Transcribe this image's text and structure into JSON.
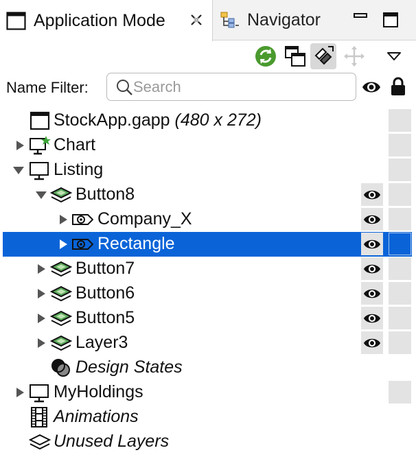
{
  "tabs": {
    "active": {
      "label": "Application Mode",
      "icon": "window-icon",
      "close_icon": "close-icon"
    },
    "inactive": {
      "label": "Navigator",
      "icon": "hierarchy-icon"
    }
  },
  "window_controls": {
    "minimize": "minimize-icon",
    "maximize": "maximize-icon"
  },
  "toolbar": {
    "buttons": [
      "refresh-icon",
      "new-window-icon",
      "link-with-editor-icon",
      "move-icon",
      "view-menu-icon"
    ]
  },
  "filter": {
    "label": "Name Filter:",
    "placeholder": "Search",
    "value": ""
  },
  "tree": {
    "rows": [
      {
        "label": "StockApp.gapp",
        "suffix": " (480 x 272)",
        "icon": "application-icon",
        "expand": "none"
      },
      {
        "label": "Chart",
        "icon": "screen-star-icon",
        "expand": "collapsed"
      },
      {
        "label": "Listing",
        "icon": "screen-icon",
        "expand": "expanded"
      },
      {
        "label": "Button8",
        "icon": "layer-icon",
        "expand": "expanded",
        "visible": true
      },
      {
        "label": "Company_X",
        "icon": "widget-eye-icon",
        "expand": "collapsed",
        "visible": true
      },
      {
        "label": "Rectangle",
        "icon": "widget-eye-icon",
        "expand": "collapsed",
        "visible": true,
        "selected": true
      },
      {
        "label": "Button7",
        "icon": "layer-icon",
        "expand": "collapsed",
        "visible": true
      },
      {
        "label": "Button6",
        "icon": "layer-icon",
        "expand": "collapsed",
        "visible": true
      },
      {
        "label": "Button5",
        "icon": "layer-icon",
        "expand": "collapsed",
        "visible": true
      },
      {
        "label": "Layer3",
        "icon": "layer-icon",
        "expand": "collapsed",
        "visible": true
      },
      {
        "label": "Design States",
        "icon": "design-states-icon",
        "expand": "none",
        "italic": true
      },
      {
        "label": "MyHoldings",
        "icon": "screen-icon",
        "expand": "collapsed"
      },
      {
        "label": "Animations",
        "icon": "film-icon",
        "expand": "none",
        "italic": true
      },
      {
        "label": "Unused Layers",
        "icon": "layer-outline-icon",
        "expand": "none",
        "italic": true
      }
    ]
  },
  "colors": {
    "selection": "#0a64d8",
    "cell": "#e3e3e3",
    "refresh": "#4a9a2e"
  }
}
